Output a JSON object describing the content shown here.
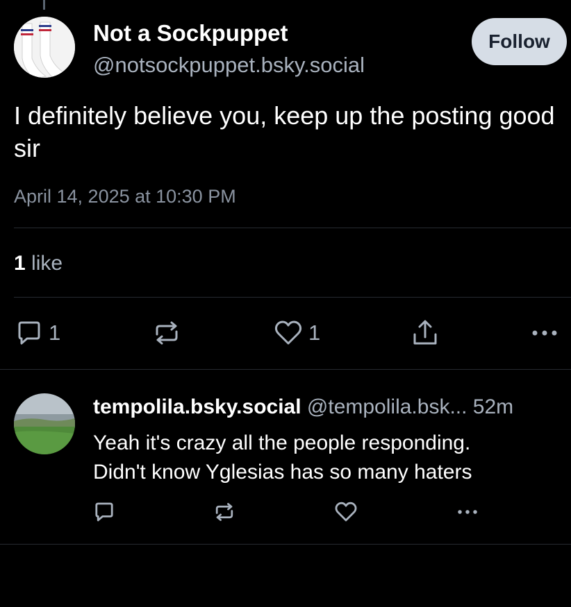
{
  "post": {
    "author_name": "Not a Sockpuppet",
    "author_handle": "@notsockpuppet.bsky.social",
    "follow_label": "Follow",
    "text": "I definitely believe you, keep up the posting good sir",
    "timestamp": "April 14, 2025 at 10:30 PM",
    "likes_count": "1",
    "likes_word": "like",
    "actions": {
      "reply_count": "1",
      "like_count": "1"
    }
  },
  "reply": {
    "name": "tempolila.bsky.social",
    "handle": "@tempolila.bsk...",
    "time": "52m",
    "text_line1": "Yeah it's crazy all the people responding.",
    "text_line2": "Didn't know Yglesias has so many haters"
  },
  "icons": {
    "reply": "speech-bubble-icon",
    "repost": "repost-arrows-icon",
    "like": "heart-icon",
    "share": "share-icon",
    "more": "ellipsis-icon"
  },
  "colors": {
    "background": "#000000",
    "muted_text": "#a9b2be",
    "follow_button": "#d6dde6"
  }
}
